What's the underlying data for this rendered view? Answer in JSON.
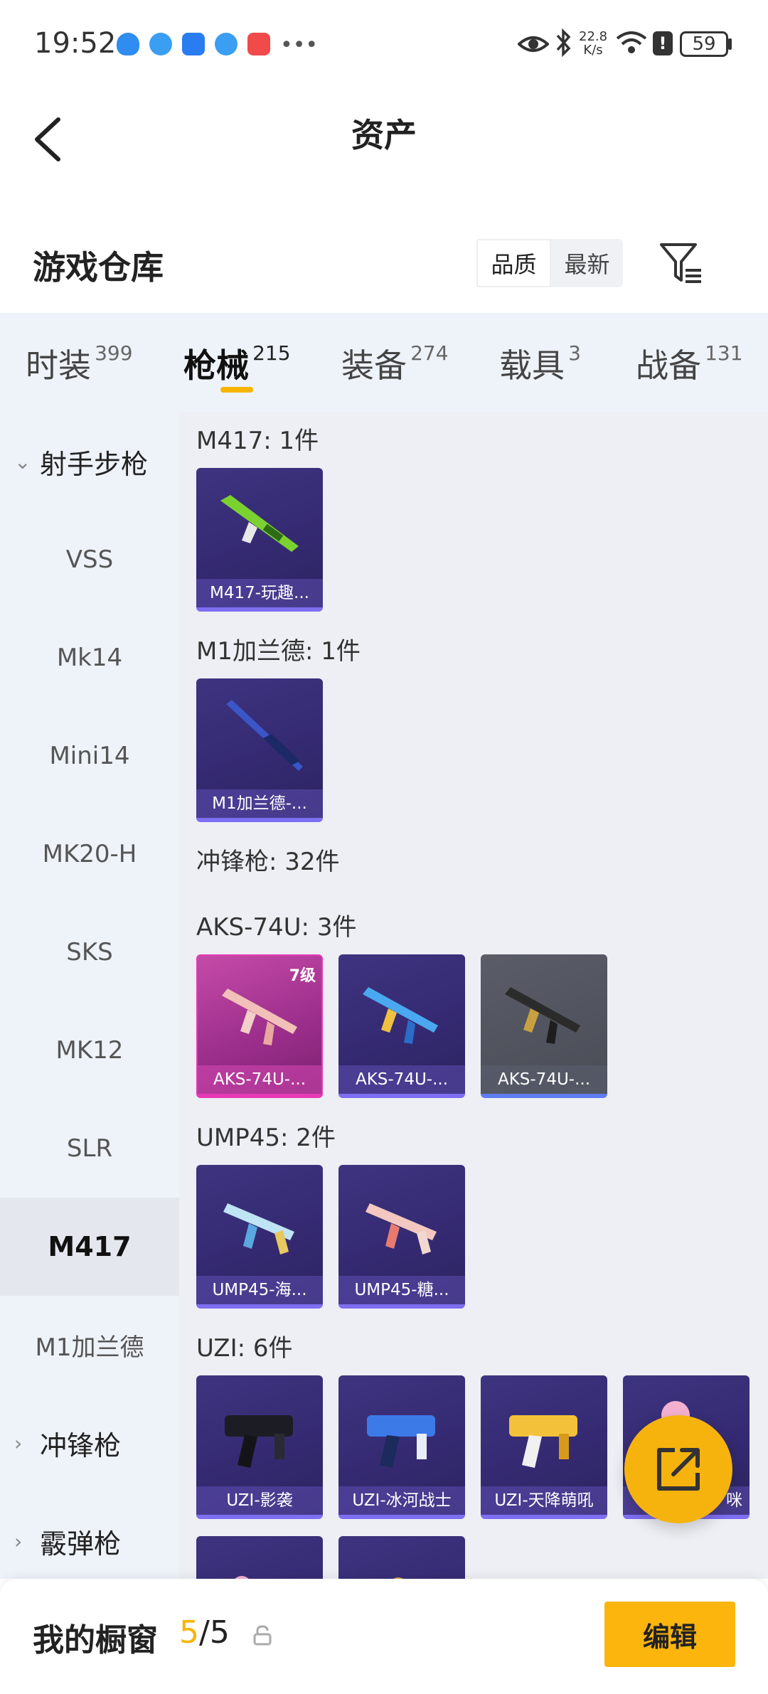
{
  "status_bar": {
    "time": "19:52",
    "net_speed": "22.8\nK/s",
    "battery": "59"
  },
  "nav": {
    "title": "资产"
  },
  "warehouse": {
    "title": "游戏仓库",
    "sort_options": [
      "品质",
      "最新"
    ],
    "sort_selected": "品质"
  },
  "tabs": [
    {
      "label": "时装",
      "count": "399"
    },
    {
      "label": "枪械",
      "count": "215"
    },
    {
      "label": "装备",
      "count": "274"
    },
    {
      "label": "载具",
      "count": "3"
    },
    {
      "label": "战备",
      "count": "131"
    }
  ],
  "sidebar": {
    "group_rifle": "射手步枪",
    "items": [
      "VSS",
      "Mk14",
      "Mini14",
      "MK20-H",
      "SKS",
      "MK12",
      "SLR",
      "M417",
      "M1加兰德"
    ],
    "selected": "M417",
    "group_smg": "冲锋枪",
    "group_shotgun": "霰弹枪"
  },
  "content": {
    "m417_title": "M417: 1件",
    "m417_cards": [
      "M417-玩趣..."
    ],
    "m1_title": "M1加兰德: 1件",
    "m1_cards": [
      "M1加兰德-..."
    ],
    "smg_title": "冲锋枪: 32件",
    "aks_title": "AKS-74U: 3件",
    "aks_cards": [
      "AKS-74U-...",
      "AKS-74U-...",
      "AKS-74U-..."
    ],
    "aks_badge": "7级",
    "ump_title": "UMP45: 2件",
    "ump_cards": [
      "UMP45-海...",
      "UMP45-糖..."
    ],
    "uzi_title": "UZI: 6件",
    "uzi_cards": [
      "UZI-影袭",
      "UZI-冰河战士",
      "UZI-天降萌吼",
      "咪"
    ]
  },
  "bottom_bar": {
    "label": "我的橱窗",
    "current": "5",
    "total": "/5",
    "edit_label": "编辑"
  },
  "colors": {
    "accent": "#f6b30e",
    "card_purple": "#352a72",
    "card_pink": "#c54aa8"
  }
}
